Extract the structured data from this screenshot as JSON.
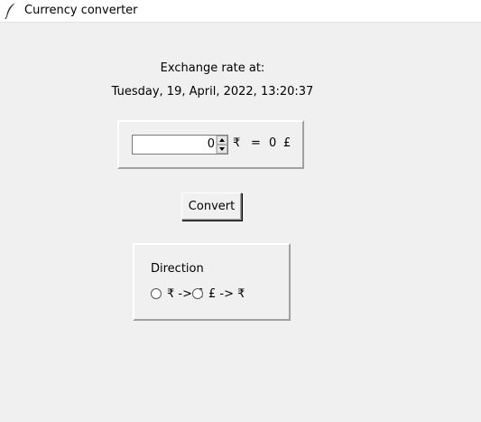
{
  "window": {
    "title": "Currency converter",
    "icon": "feather-icon"
  },
  "header": {
    "rate_label": "Exchange rate at:",
    "timestamp": "Tuesday, 19, April, 2022, 13:20:37"
  },
  "converter": {
    "input_value": "0",
    "from_symbol": "₹",
    "equals": "=",
    "result_value": "0",
    "to_symbol": "£"
  },
  "actions": {
    "convert_label": "Convert"
  },
  "direction": {
    "label": "Direction",
    "options": [
      {
        "label": "₹ -> £",
        "selected": false
      },
      {
        "label": "£ -> ₹",
        "selected": false
      }
    ]
  }
}
